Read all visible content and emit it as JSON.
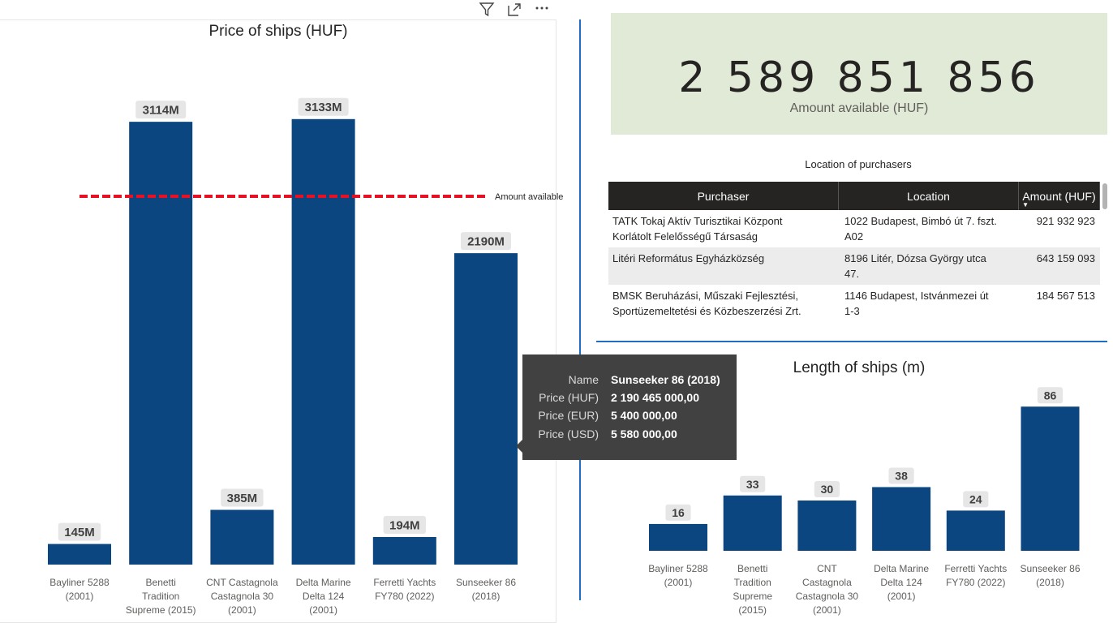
{
  "colors": {
    "bar": "#0b4680",
    "label_bg": "#e6e6e6",
    "ref_line": "#e81123",
    "kpi_bg": "#e1ead6",
    "divider": "#1e6fc4",
    "table_header": "#252423",
    "tooltip_bg": "#414141"
  },
  "visual_header": {
    "icons": [
      "filter-icon",
      "focus-mode-icon",
      "more-options-icon"
    ]
  },
  "kpi": {
    "value": "2 589 851 856",
    "label": "Amount available (HUF)"
  },
  "purchasers_table": {
    "title": "Location of purchasers",
    "columns": [
      "Purchaser",
      "Location",
      "Amount (HUF)"
    ],
    "sort": "Amount (HUF) descending",
    "rows": [
      {
        "purchaser_line1": "TATK Tokaj Aktív Turisztikai Központ",
        "purchaser_line2": "Korlátolt Felelősségű Társaság",
        "location_line1": "1022 Budapest, Bimbó út 7. fszt.",
        "location_line2": "A02",
        "amount": "921 932 923"
      },
      {
        "purchaser_line1": "Litéri Református Egyházközség",
        "purchaser_line2": "",
        "location_line1": "8196 Litér, Dózsa György utca",
        "location_line2": "47.",
        "amount": "643 159 093"
      },
      {
        "purchaser_line1": "BMSK Beruházási, Műszaki Fejlesztési,",
        "purchaser_line2": "Sportüzemeltetési és Közbeszerzési Zrt.",
        "location_line1": "1146 Budapest, Istvánmezei út",
        "location_line2": "1-3",
        "amount": "184 567 513"
      }
    ]
  },
  "tooltip": {
    "rows": [
      {
        "key": "Name",
        "value": "Sunseeker 86 (2018)"
      },
      {
        "key": "Price (HUF)",
        "value": "2 190 465 000,00"
      },
      {
        "key": "Price (EUR)",
        "value": "5 400 000,00"
      },
      {
        "key": "Price (USD)",
        "value": "5 580 000,00"
      }
    ]
  },
  "chart_data": [
    {
      "type": "bar",
      "title": "Price of ships (HUF)",
      "categories": [
        [
          "Bayliner 5288",
          "(2001)"
        ],
        [
          "Benetti",
          "Tradition",
          "Supreme (2015)"
        ],
        [
          "CNT Castagnola",
          "Castagnola 30",
          "(2001)"
        ],
        [
          "Delta Marine",
          "Delta 124",
          "(2001)"
        ],
        [
          "Ferretti Yachts",
          "FY780 (2022)"
        ],
        [
          "Sunseeker 86",
          "(2018)"
        ]
      ],
      "values": [
        145,
        3114,
        385,
        3133,
        194,
        2190
      ],
      "data_labels": [
        "145M",
        "3114M",
        "385M",
        "3133M",
        "194M",
        "2190M"
      ],
      "value_unit": "M HUF",
      "reference_line": {
        "value": 2590,
        "label": "Amount available",
        "style": "dashed"
      },
      "ylim": [
        0,
        3400
      ],
      "grid": false,
      "legend": "none"
    },
    {
      "type": "bar",
      "title": "Length of ships (m)",
      "categories": [
        [
          "Bayliner 5288",
          "(2001)"
        ],
        [
          "Benetti",
          "Tradition",
          "Supreme",
          "(2015)"
        ],
        [
          "CNT",
          "Castagnola",
          "Castagnola 30",
          "(2001)"
        ],
        [
          "Delta Marine",
          "Delta 124",
          "(2001)"
        ],
        [
          "Ferretti Yachts",
          "FY780 (2022)"
        ],
        [
          "Sunseeker 86",
          "(2018)"
        ]
      ],
      "values": [
        16,
        33,
        30,
        38,
        24,
        86
      ],
      "data_labels": [
        "16",
        "33",
        "30",
        "38",
        "24",
        "86"
      ],
      "ylim": [
        0,
        90
      ],
      "grid": false,
      "legend": "none"
    }
  ]
}
